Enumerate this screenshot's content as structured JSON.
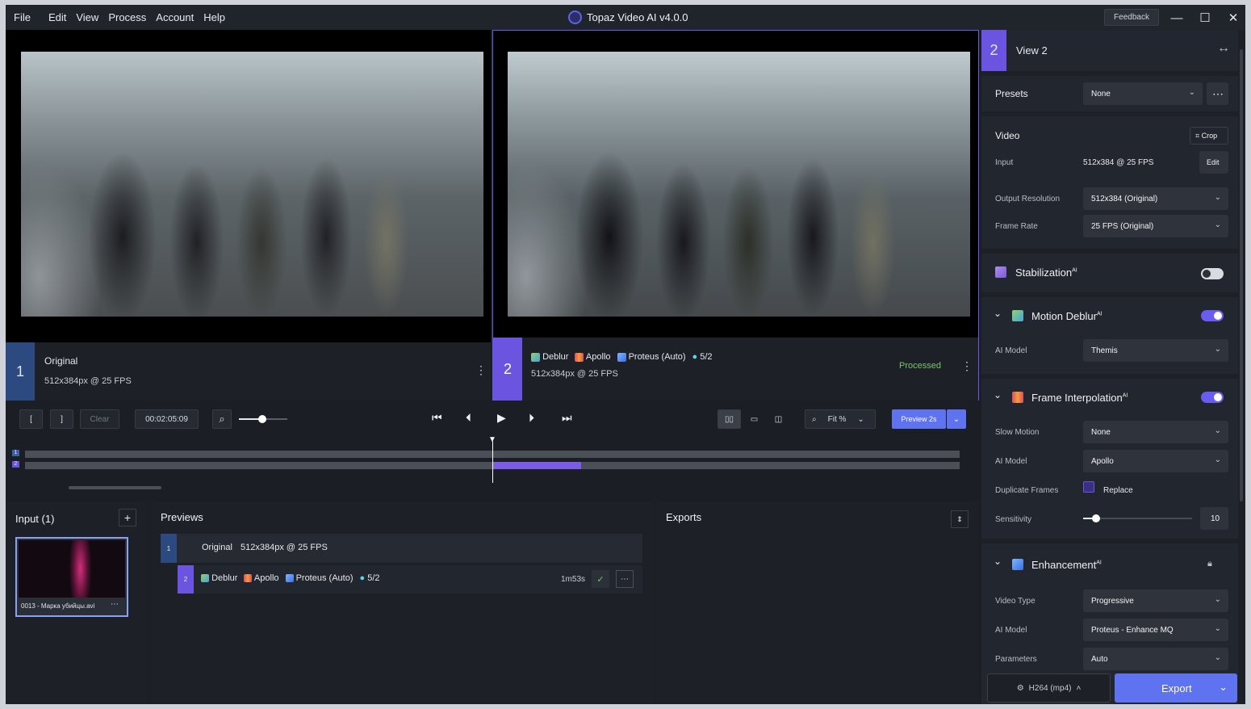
{
  "menu": [
    "File",
    "Edit",
    "View",
    "Process",
    "Account",
    "Help"
  ],
  "app_title": "Topaz Video AI  v4.0.0",
  "feedback": "Feedback",
  "view1": {
    "num": "1",
    "label": "Original",
    "meta": "512x384px @ 25 FPS"
  },
  "view2": {
    "num": "2",
    "chain": [
      "Deblur",
      "Apollo",
      "Proteus (Auto)",
      "5/2"
    ],
    "meta": "512x384px @ 25 FPS",
    "status": "Processed"
  },
  "panel": {
    "view_num": "2",
    "view_title": "View 2",
    "presets_label": "Presets",
    "presets_value": "None",
    "video_label": "Video",
    "crop": "Crop",
    "input_label": "Input",
    "input_value": "512x384 @ 25 FPS",
    "edit": "Edit",
    "out_res_label": "Output Resolution",
    "out_res_value": "512x384 (Original)",
    "fps_label": "Frame Rate",
    "fps_value": "25 FPS (Original)",
    "stab": "Stabilization",
    "deblur": "Motion Deblur",
    "deblur_model_label": "AI Model",
    "deblur_model": "Themis",
    "fi": "Frame Interpolation",
    "slow_label": "Slow Motion",
    "slow_value": "None",
    "fi_model_label": "AI Model",
    "fi_model": "Apollo",
    "dup_label": "Duplicate Frames",
    "dup_value": "Replace",
    "sens_label": "Sensitivity",
    "sens_value": "10",
    "enh": "Enhancement",
    "vtype_label": "Video Type",
    "vtype_value": "Progressive",
    "enh_model_label": "AI Model",
    "enh_model": "Proteus - Enhance MQ",
    "params_label": "Parameters",
    "params_value": "Auto",
    "ai": "AI",
    "codec": "H264 (mp4)",
    "export": "Export"
  },
  "timeline": {
    "in": "[",
    "out": "]",
    "clear": "Clear",
    "time": "00:02:05:09",
    "fit": "Fit %",
    "preview": "Preview 2s",
    "track1": "1",
    "track2": "2"
  },
  "input": {
    "title": "Input (1)",
    "file": "0013 - Марка убийцы.avi"
  },
  "previews": {
    "title": "Previews",
    "row1_num": "1",
    "row1_name": "Original",
    "row1_meta": "512x384px @ 25 FPS",
    "row2_num": "2",
    "row2_chain": [
      "Deblur",
      "Apollo",
      "Proteus (Auto)",
      "5/2"
    ],
    "row2_time": "1m53s"
  },
  "exports": {
    "title": "Exports"
  }
}
